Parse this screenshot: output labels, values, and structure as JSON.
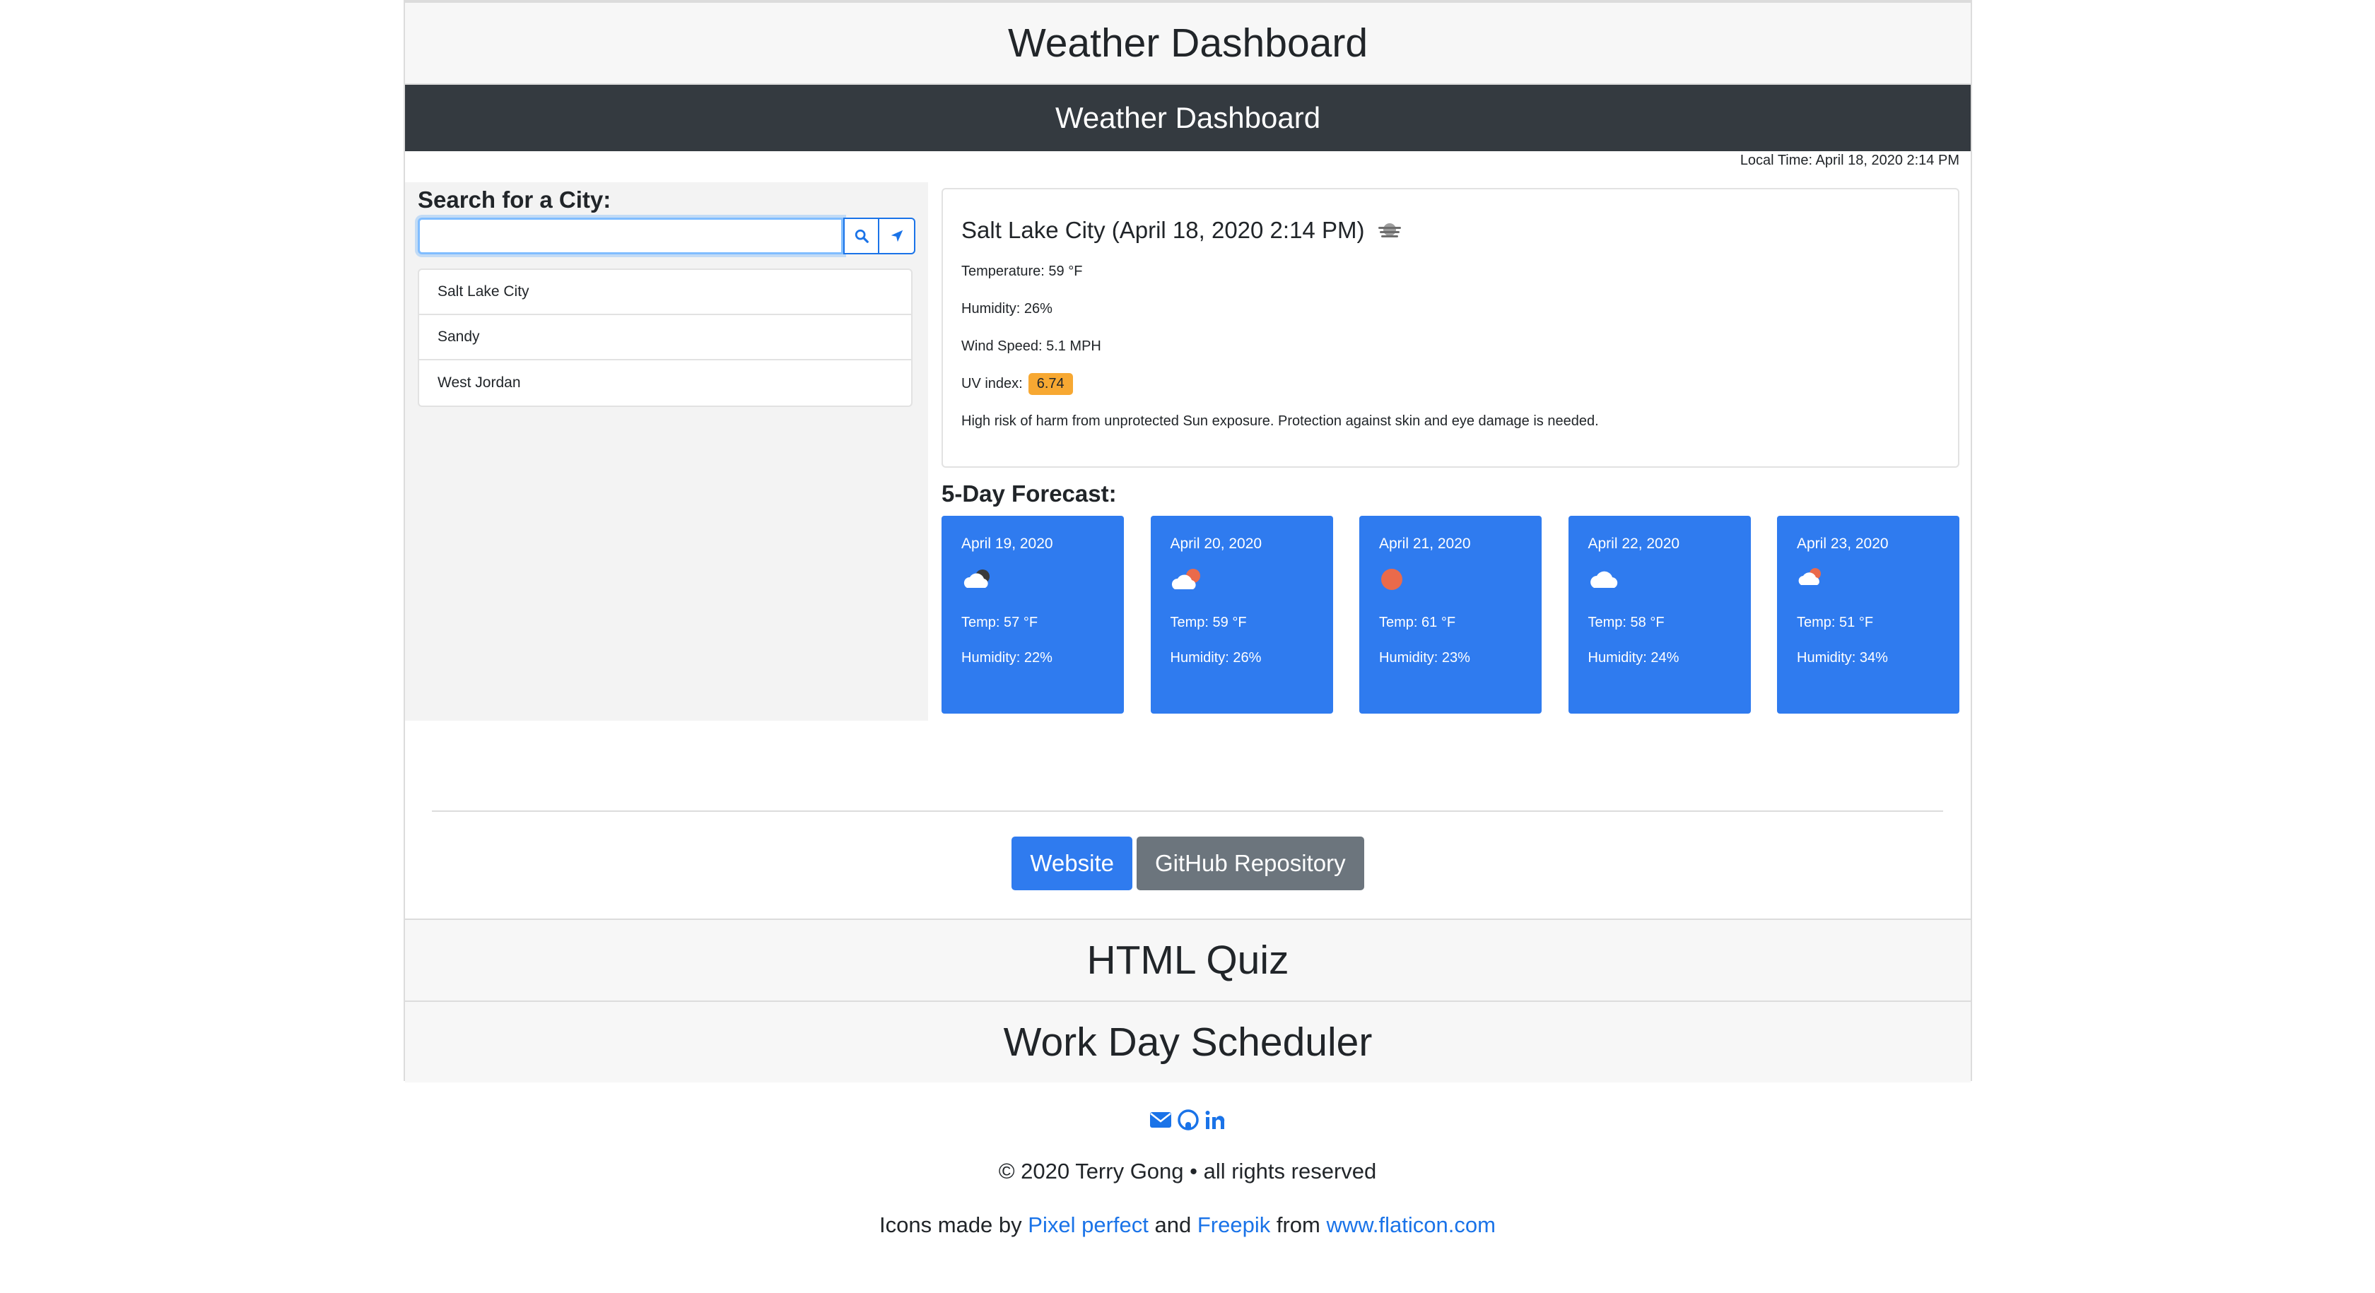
{
  "projects": {
    "weather_title": "Weather Dashboard",
    "quiz_title": "HTML Quiz",
    "scheduler_title": "Work Day Scheduler"
  },
  "app": {
    "banner_title": "Weather Dashboard",
    "local_time": "Local Time: April 18, 2020 2:14 PM"
  },
  "search": {
    "heading": "Search for a City:",
    "value": "",
    "placeholder": "",
    "search_icon": "search-icon",
    "locate_icon": "location-arrow-icon",
    "cities": [
      "Salt Lake City",
      "Sandy",
      "West Jordan"
    ]
  },
  "current": {
    "title": "Salt Lake City (April 18, 2020 2:14 PM)",
    "icon": "haze-icon",
    "temperature": "Temperature: 59 °F",
    "humidity": "Humidity: 26%",
    "wind": "Wind Speed: 5.1 MPH",
    "uv_label": "UV index:",
    "uv_value": "6.74",
    "uv_color": "#f7a832",
    "uv_note": "High risk of harm from unprotected Sun exposure. Protection against skin and eye damage is needed."
  },
  "forecast": {
    "title": "5-Day Forecast:",
    "card_color": "#2f7bef",
    "days": [
      {
        "date": "April 19, 2020",
        "icon": "cloud-night-icon",
        "temp": "Temp: 57 °F",
        "humidity": "Humidity: 22%"
      },
      {
        "date": "April 20, 2020",
        "icon": "cloud-sun-icon",
        "temp": "Temp: 59 °F",
        "humidity": "Humidity: 26%"
      },
      {
        "date": "April 21, 2020",
        "icon": "sun-icon",
        "temp": "Temp: 61 °F",
        "humidity": "Humidity: 23%"
      },
      {
        "date": "April 22, 2020",
        "icon": "cloud-icon",
        "temp": "Temp: 58 °F",
        "humidity": "Humidity: 24%"
      },
      {
        "date": "April 23, 2020",
        "icon": "cloud-sun-icon",
        "temp": "Temp: 51 °F",
        "humidity": "Humidity: 34%"
      }
    ]
  },
  "buttons": {
    "website": "Website",
    "github": "GitHub Repository"
  },
  "footer": {
    "copyright": "© 2020 Terry Gong • all rights reserved",
    "credits_prefix": "Icons made by",
    "credit_1": "Pixel perfect",
    "credits_and": "and",
    "credit_2": "Freepik",
    "credits_from": "from",
    "credit_site": "www.flaticon.com",
    "icons": [
      "envelope-icon",
      "github-icon",
      "linkedin-icon"
    ],
    "link_color": "#1a73e8"
  }
}
